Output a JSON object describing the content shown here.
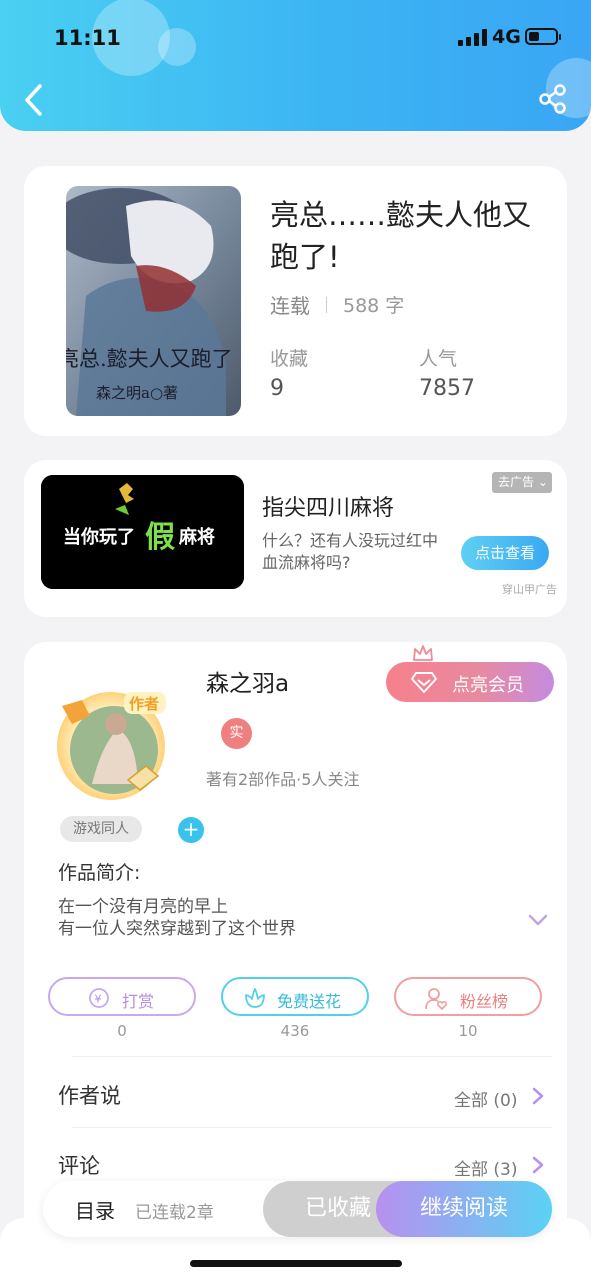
{
  "status_bar": {
    "time": "11:11",
    "network": "4G",
    "battery_level": 0.4
  },
  "header": {
    "back_icon": "chevron-left-icon",
    "share_icon": "share-icon",
    "accent_colors": [
      "#4ad0f2",
      "#3aa6f4"
    ]
  },
  "book": {
    "title": "亮总……懿夫人他又跑了!",
    "status": "连载",
    "word_count": "588 字",
    "stats": [
      {
        "label": "收藏",
        "value": "9"
      },
      {
        "label": "人气",
        "value": "7857"
      }
    ],
    "cover_text": {
      "main": "亮总.懿夫人又跑了",
      "author": "森之明a○著"
    }
  },
  "ad": {
    "image_text": {
      "part1": "当你玩了",
      "part2": "假",
      "part3": "麻将"
    },
    "title": "指尖四川麻将",
    "description": "什么？还有人没玩过红中血流麻将吗?",
    "button": "点击查看",
    "close_label": "去广告",
    "source": "穿山甲广告"
  },
  "author": {
    "name": "森之羽a",
    "vip_button": "点亮会员",
    "avatar_badge": "作者",
    "real_badge": "实",
    "meta": "著有2部作品·5人关注",
    "tag": "游戏同人",
    "intro_label": "作品简介:",
    "intro_lines": [
      "在一个没有月亮的早上",
      "有一位人突然穿越到了这个世界"
    ]
  },
  "actions": [
    {
      "label": "打赏",
      "count": "0",
      "icon": "yen-coin-icon",
      "color": "#b48ee0"
    },
    {
      "label": "免费送花",
      "count": "436",
      "icon": "flower-icon",
      "color": "#40c4e0"
    },
    {
      "label": "粉丝榜",
      "count": "10",
      "icon": "fan-user-icon",
      "color": "#ee8a8a"
    }
  ],
  "sections": [
    {
      "label": "作者说",
      "right": "全部 (0)"
    },
    {
      "label": "评论",
      "right": "全部 (3)"
    }
  ],
  "bottom_bar": {
    "toc": "目录",
    "toc_status": "已连载2章",
    "collected": "已收藏",
    "read": "继续阅读"
  }
}
